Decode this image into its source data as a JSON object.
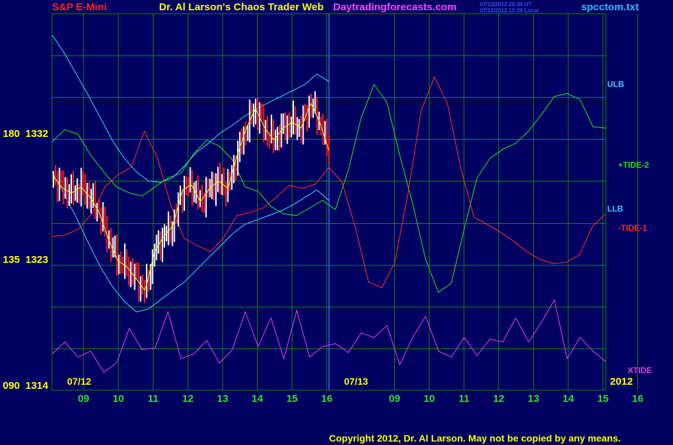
{
  "header": {
    "symbol": "S&P E-Mini",
    "title": "Dr. Al Larson's Chaos Trader Web",
    "site": "Daytradingforecasts.com",
    "stamp1": "07/12/2012 20:39 UT",
    "stamp2": "07/12/2012 15:39 Local",
    "file": "spcctom.txt"
  },
  "colors": {
    "background": "#000060",
    "grid": "#0a8a0a",
    "price_up": "#ffffff",
    "price_down": "#ff1a1a",
    "ulb_llb": "#40c8ff",
    "tide1": "#ff2a2a",
    "tide2": "#22dd22",
    "xtide": "#e03ce0",
    "avg": "#ffff00",
    "time_labels": "#33dd33",
    "date_labels": "#ffff00",
    "price_labels": "#ffff00",
    "title": "#ffff00",
    "symbol": "#ff2222",
    "site": "#ff44ff",
    "file": "#33bbff"
  },
  "chart_data": {
    "type": "line",
    "title": "S&P E-Mini",
    "x_tick_labels": [
      "09",
      "10",
      "11",
      "12",
      "13",
      "14",
      "15",
      "16",
      "09",
      "10",
      "11",
      "12",
      "13",
      "14",
      "15",
      "16"
    ],
    "dates": [
      "07/12",
      "07/13"
    ],
    "year": "2012",
    "y_labels": [
      {
        "code": "180",
        "price": "1332",
        "value": 1332
      },
      {
        "code": "135",
        "price": "1323",
        "value": 1323
      },
      {
        "code": "090",
        "price": "1314",
        "value": 1314
      }
    ],
    "ylim": [
      1314,
      1339
    ],
    "grid": true,
    "series": [
      {
        "name": "ULB",
        "values": [
          1337.6,
          1336.4,
          1335,
          1333.6,
          1332.1,
          1330.6,
          1329.4,
          1328.5,
          1327.9,
          1327.8,
          1328.1,
          1328.9,
          1329.8,
          1330.4,
          1331.1,
          1331.6,
          1332.2,
          1332.7,
          1333.1,
          1333.5,
          1333.9,
          1334.3,
          1335,
          1334.5
        ]
      },
      {
        "name": "LLB",
        "values": [
          1328.5,
          1327,
          1325.5,
          1323.8,
          1322.2,
          1320.9,
          1319.9,
          1319.2,
          1319.4,
          1320,
          1320.6,
          1321.2,
          1322,
          1322.8,
          1323.6,
          1324.4,
          1325,
          1325.3,
          1325.6,
          1325.9,
          1326.3,
          1326.8,
          1327.3,
          1326.6
        ]
      },
      {
        "name": "+TIDE-2",
        "values": [
          1330.5,
          1331.3,
          1331,
          1329.6,
          1328.5,
          1327.5,
          1327.1,
          1326.9,
          1327.5,
          1328.1,
          1328.4,
          1329.7,
          1330.6,
          1330.2,
          1329.3,
          1327.5,
          1327.2,
          1326.2,
          1325.7,
          1325.6,
          1326.1,
          1326.6,
          1326,
          1328.6,
          1332.1,
          1334.3,
          1333.1,
          1329.6,
          1326.4,
          1322.7,
          1320.5,
          1321.1,
          1324.7,
          1328.1,
          1329.4,
          1330,
          1330.4,
          1331.2,
          1332.3,
          1333.5,
          1333.7,
          1333.3,
          1331.5,
          1331.4
        ]
      },
      {
        "name": "-TIDE-1",
        "values": [
          1324.2,
          1324.3,
          1324.7,
          1325.7,
          1327.5,
          1328.3,
          1328.8,
          1331.2,
          1329.4,
          1326.3,
          1324.1,
          1323.6,
          1323.2,
          1324.1,
          1325.6,
          1325.8,
          1326.1,
          1326.8,
          1327.6,
          1327.4,
          1327.7,
          1328.8,
          1327.8,
          1324.8,
          1321.2,
          1320.8,
          1322.5,
          1327.1,
          1332.6,
          1334.8,
          1333,
          1328.7,
          1325.5,
          1325,
          1324.5,
          1323.9,
          1323.2,
          1322.7,
          1322.4,
          1322.5,
          1323,
          1324.9,
          1325.7
        ]
      },
      {
        "name": "XTIDE",
        "values": [
          1316.4,
          1317.2,
          1316.2,
          1316.6,
          1315.2,
          1315.8,
          1318.1,
          1316.7,
          1316.8,
          1319.2,
          1316.1,
          1316.4,
          1317.3,
          1315.8,
          1316.7,
          1319.2,
          1316.9,
          1318.8,
          1316.1,
          1319.3,
          1316.2,
          1316.9,
          1317.1,
          1316.5,
          1317.8,
          1317.5,
          1318.3,
          1315.7,
          1317.5,
          1318.9,
          1316.6,
          1316.2,
          1317.5,
          1316.3,
          1317.4,
          1317.2,
          1318.8,
          1317.2,
          1318.5,
          1320,
          1316.1,
          1317.5,
          1316.6,
          1315.9
        ]
      },
      {
        "name": "Price",
        "values": [
          1328.2,
          1327.4,
          1327.1,
          1327.5,
          1326.8,
          1325.8,
          1324,
          1322.6,
          1322.2,
          1321.4,
          1320.6,
          1323.2,
          1324.2,
          1324.9,
          1327.2,
          1327.7,
          1326.5,
          1327.4,
          1327.9,
          1327.4,
          1329.6,
          1331.4,
          1332.7,
          1331.4,
          1330.6,
          1331.4,
          1331.8,
          1331.4,
          1333.1,
          1331.8,
          1329.9
        ]
      }
    ],
    "legend": [
      "ULB",
      "+TIDE-2",
      "LLB",
      "-TIDE-1",
      "XTIDE"
    ]
  },
  "footer": {
    "copyright": "Copyright 2012, Dr. Al Larson. May not be copied by any means."
  }
}
